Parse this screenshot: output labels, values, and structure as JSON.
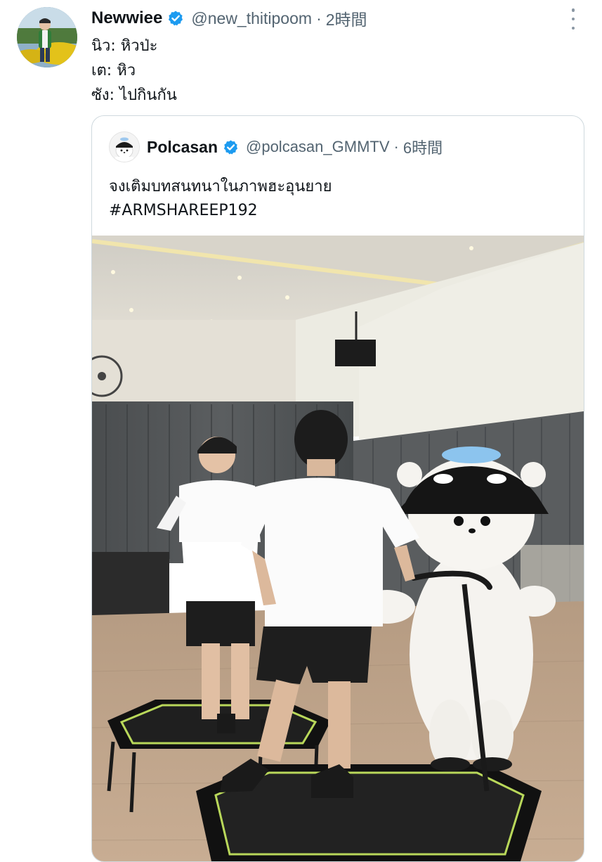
{
  "tweet": {
    "display_name": "Newwiee",
    "handle": "@new_thitipoom",
    "separator": "·",
    "time": "2時間",
    "verified": true,
    "more_icon": "more-vertical-icon",
    "lines": [
      "นิว: หิวป่ะ",
      "เต: หิว",
      "ซัง: ไปกินกัน"
    ]
  },
  "quote": {
    "display_name": "Polcasan",
    "handle": "@polcasan_GMMTV",
    "separator": "·",
    "time": "6時間",
    "verified": true,
    "lines": [
      "จงเติมบทสนทนาในภาพฮะอุนยาย",
      "#ARMSHAREEP192"
    ]
  },
  "colors": {
    "verified_blue": "#1d9bf0",
    "secondary_text": "#536471",
    "border": "#cfd9de"
  }
}
